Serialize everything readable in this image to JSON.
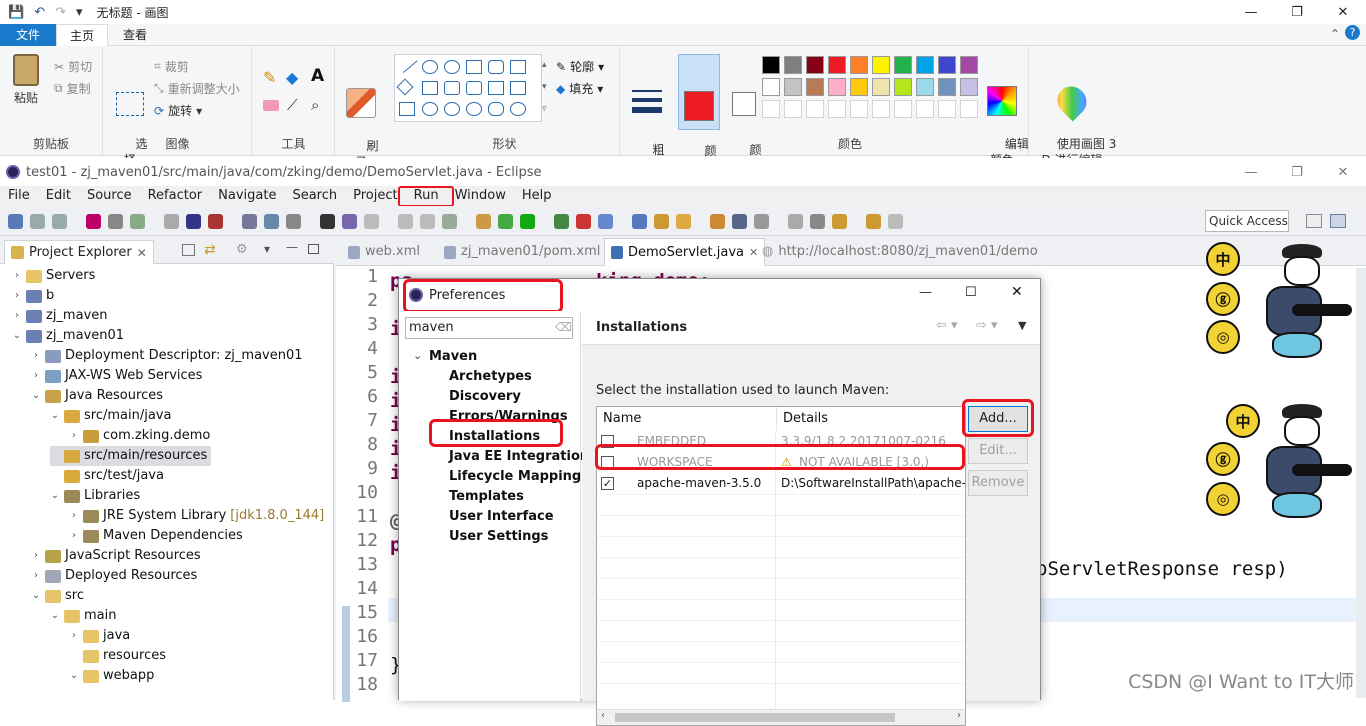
{
  "paint": {
    "quick_icons": [
      "save-icon",
      "undo-icon",
      "redo-icon",
      "dropdown-icon"
    ],
    "title": "无标题 - 画图",
    "tabs": {
      "file": "文件",
      "home": "主页",
      "view": "查看"
    },
    "clipboard": {
      "paste": "粘贴",
      "cut": "剪切",
      "copy": "复制",
      "group": "剪贴板"
    },
    "image": {
      "select": "选\n择",
      "crop": "裁剪",
      "resize": "重新调整大小",
      "rotate": "旋转",
      "group": "图像"
    },
    "tools": {
      "group": "工具",
      "brush": "刷\n子"
    },
    "shapes": {
      "outline": "轮廓",
      "fill": "填充",
      "group": "形状"
    },
    "size": "粗\n细",
    "color1": "颜\n色 1",
    "color2": "颜\n色 2",
    "edit_colors": "编辑\n颜色",
    "paint3d": "使用画图 3\nD 进行编辑",
    "colors_group": "颜色",
    "palette_row1": [
      "#000000",
      "#7f7f7f",
      "#880015",
      "#ed1c24",
      "#ff7f27",
      "#fff200",
      "#22b14c",
      "#00a2e8",
      "#3f48cc",
      "#a349a4"
    ],
    "palette_row2": [
      "#ffffff",
      "#c3c3c3",
      "#b97a57",
      "#ffaec9",
      "#ffc90e",
      "#efe4b0",
      "#b5e61d",
      "#99d9ea",
      "#7092be",
      "#c8bfe7"
    ],
    "color1_value": "#ed1c24",
    "color2_value": "#ffffff"
  },
  "eclipse": {
    "title": "test01 - zj_maven01/src/main/java/com/zking/demo/DemoServlet.java - Eclipse",
    "menu": [
      "File",
      "Edit",
      "Source",
      "Refactor",
      "Navigate",
      "Search",
      "Project",
      "Run",
      "Window",
      "Help"
    ],
    "quick_access": "Quick Access",
    "explorer": {
      "title": "Project Explorer",
      "items": [
        {
          "label": "Servers",
          "depth": 0,
          "tw": "›",
          "icon": "folder"
        },
        {
          "label": "b",
          "depth": 0,
          "tw": "›",
          "icon": "maven-project"
        },
        {
          "label": "zj_maven",
          "depth": 0,
          "tw": "›",
          "icon": "maven-project"
        },
        {
          "label": "zj_maven01",
          "depth": 0,
          "tw": "⌄",
          "icon": "maven-project"
        },
        {
          "label": "Deployment Descriptor: zj_maven01",
          "depth": 1,
          "tw": "›",
          "icon": "descriptor"
        },
        {
          "label": "JAX-WS Web Services",
          "depth": 1,
          "tw": "›",
          "icon": "webservice"
        },
        {
          "label": "Java Resources",
          "depth": 1,
          "tw": "⌄",
          "icon": "java-res"
        },
        {
          "label": "src/main/java",
          "depth": 2,
          "tw": "⌄",
          "icon": "src-folder"
        },
        {
          "label": "com.zking.demo",
          "depth": 3,
          "tw": "›",
          "icon": "package"
        },
        {
          "label": "src/main/resources",
          "depth": 2,
          "tw": "",
          "icon": "src-folder",
          "selected": true
        },
        {
          "label": "src/test/java",
          "depth": 2,
          "tw": "",
          "icon": "src-folder"
        },
        {
          "label": "Libraries",
          "depth": 2,
          "tw": "⌄",
          "icon": "library"
        },
        {
          "label": "JRE System Library",
          "depth": 3,
          "tw": "›",
          "icon": "library",
          "decor": "[jdk1.8.0_144]"
        },
        {
          "label": "Maven Dependencies",
          "depth": 3,
          "tw": "›",
          "icon": "library"
        },
        {
          "label": "JavaScript Resources",
          "depth": 1,
          "tw": "›",
          "icon": "js-res"
        },
        {
          "label": "Deployed Resources",
          "depth": 1,
          "tw": "›",
          "icon": "deployed"
        },
        {
          "label": "src",
          "depth": 1,
          "tw": "⌄",
          "icon": "folder"
        },
        {
          "label": "main",
          "depth": 2,
          "tw": "⌄",
          "icon": "folder"
        },
        {
          "label": "java",
          "depth": 3,
          "tw": "›",
          "icon": "folder"
        },
        {
          "label": "resources",
          "depth": 3,
          "tw": "",
          "icon": "folder"
        },
        {
          "label": "webapp",
          "depth": 3,
          "tw": "⌄",
          "icon": "folder"
        }
      ]
    },
    "editor_tabs": [
      {
        "label": "web.xml"
      },
      {
        "label": "zj_maven01/pom.xml"
      },
      {
        "label": "DemoServlet.java",
        "active": true,
        "close": "✕"
      },
      {
        "label": "http://localhost:8080/zj_maven01/demo"
      }
    ],
    "line_numbers": [
      "1",
      "2",
      "3",
      "4",
      "5",
      "6",
      "7",
      "8",
      "9",
      "10",
      "11",
      "12",
      "13",
      "14",
      "15",
      "16",
      "17",
      "18"
    ],
    "code_fragments": {
      "l1": "pa",
      "l1b": "king.demo;",
      "l3": "i",
      "l5": "i",
      "l6": "i",
      "l7": "i",
      "l8": "i",
      "l9": "i",
      "l11": "@",
      "l12": "p",
      "l13_tail": "pServletResponse resp)",
      "l17": "}"
    }
  },
  "dialog": {
    "title": "Preferences",
    "filter": "maven",
    "tree": {
      "root": "Maven",
      "root_tw": "⌄",
      "children": [
        "Archetypes",
        "Discovery",
        "Errors/Warnings",
        "Installations",
        "Java EE Integration",
        "Lifecycle Mappings",
        "Templates",
        "User Interface",
        "User Settings"
      ]
    },
    "page_title": "Installations",
    "description": "Select the installation used to launch Maven:",
    "columns": {
      "name": "Name",
      "details": "Details"
    },
    "rows": [
      {
        "checked": false,
        "name": "EMBEDDED",
        "details": "3.3.9/1.8.2.20171007-0216",
        "disabled": true
      },
      {
        "checked": false,
        "name": "WORKSPACE",
        "details": "NOT AVAILABLE [3.0,)",
        "disabled": true,
        "warn": "⚠"
      },
      {
        "checked": true,
        "check_mark": "✓",
        "name": "apache-maven-3.5.0",
        "details": "D:\\SoftwareInstallPath\\apache-"
      }
    ],
    "buttons": {
      "add": "Add...",
      "edit": "Edit...",
      "remove": "Remove"
    },
    "window": {
      "minimize": "—",
      "maximize": "☐",
      "close": "✕"
    }
  },
  "stickers": {
    "circle1": "中",
    "circle2": "ⓖ",
    "circle3": "◎"
  },
  "watermark": "CSDN @I Want to IT大师"
}
